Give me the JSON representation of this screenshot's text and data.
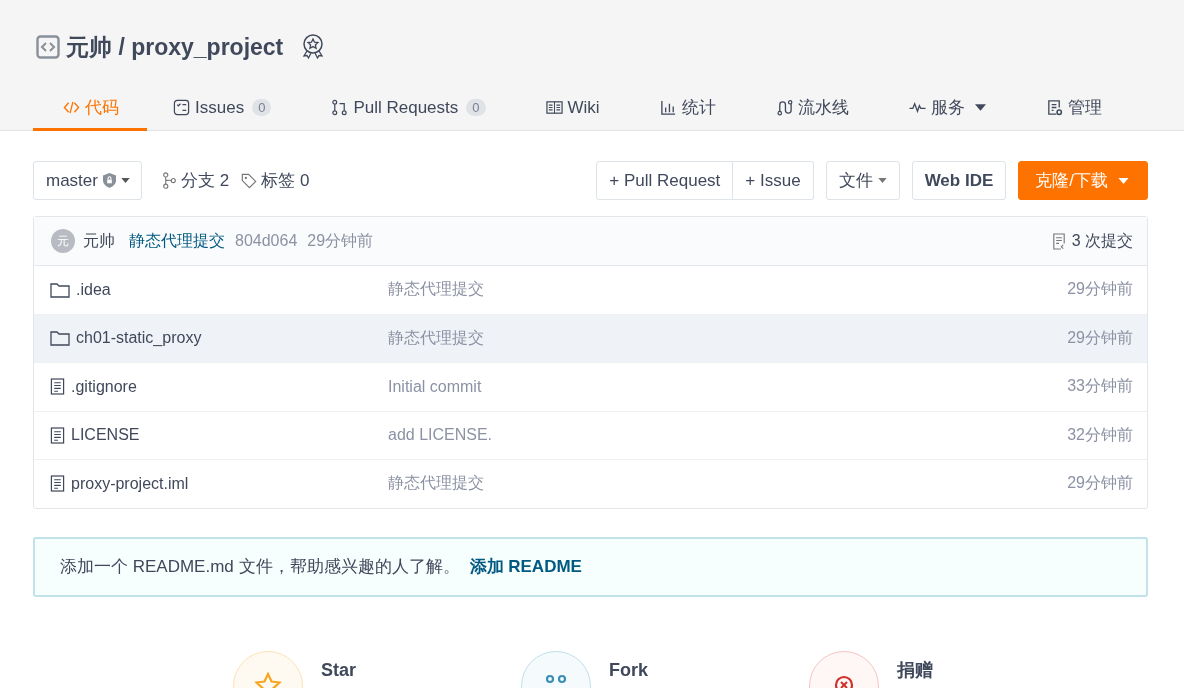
{
  "repo": {
    "title": "元帅 / proxy_project"
  },
  "tabs": [
    {
      "kind": "code",
      "label": "代码",
      "selected": true
    },
    {
      "kind": "issues",
      "label": "Issues",
      "count": "0",
      "selected": false
    },
    {
      "kind": "pulls",
      "label": "Pull Requests",
      "count": "0",
      "selected": false
    },
    {
      "kind": "wiki",
      "label": "Wiki",
      "selected": false
    },
    {
      "kind": "stats",
      "label": "统计",
      "selected": false
    },
    {
      "kind": "pipeline",
      "label": "流水线",
      "selected": false
    },
    {
      "kind": "services",
      "label": "服务",
      "selected": false,
      "dropdown": true
    },
    {
      "kind": "manage",
      "label": "管理",
      "selected": false
    }
  ],
  "toolbar": {
    "branch": "master",
    "branches": "分支 2",
    "tags": "标签 0",
    "pull_request": "+ Pull Request",
    "issue": "+ Issue",
    "file": "文件",
    "web_ide": "Web IDE",
    "clone": "克隆/下载"
  },
  "last_commit": {
    "avatar": "元",
    "author": "元帅",
    "message": "静态代理提交",
    "hash": "804d064",
    "time": "29分钟前",
    "commits": "3 次提交"
  },
  "files": [
    {
      "kind": "folder",
      "name": ".idea",
      "message": "静态代理提交",
      "time": "29分钟前",
      "highlighted": false
    },
    {
      "kind": "folder",
      "name": "ch01-static_proxy",
      "message": "静态代理提交",
      "time": "29分钟前",
      "highlighted": true
    },
    {
      "kind": "file",
      "name": ".gitignore",
      "message": "Initial commit",
      "time": "33分钟前",
      "highlighted": false
    },
    {
      "kind": "file",
      "name": "LICENSE",
      "message": "add LICENSE.",
      "time": "32分钟前",
      "highlighted": false
    },
    {
      "kind": "file",
      "name": "proxy-project.iml",
      "message": "静态代理提交",
      "time": "29分钟前",
      "highlighted": false
    }
  ],
  "readme_notice": {
    "text": "添加一个 README.md 文件，帮助感兴趣的人了解。",
    "link": "添加 README"
  },
  "actions": [
    {
      "kind": "star",
      "label": "Star"
    },
    {
      "kind": "fork",
      "label": "Fork"
    },
    {
      "kind": "donate",
      "label": "捐赠"
    }
  ]
}
